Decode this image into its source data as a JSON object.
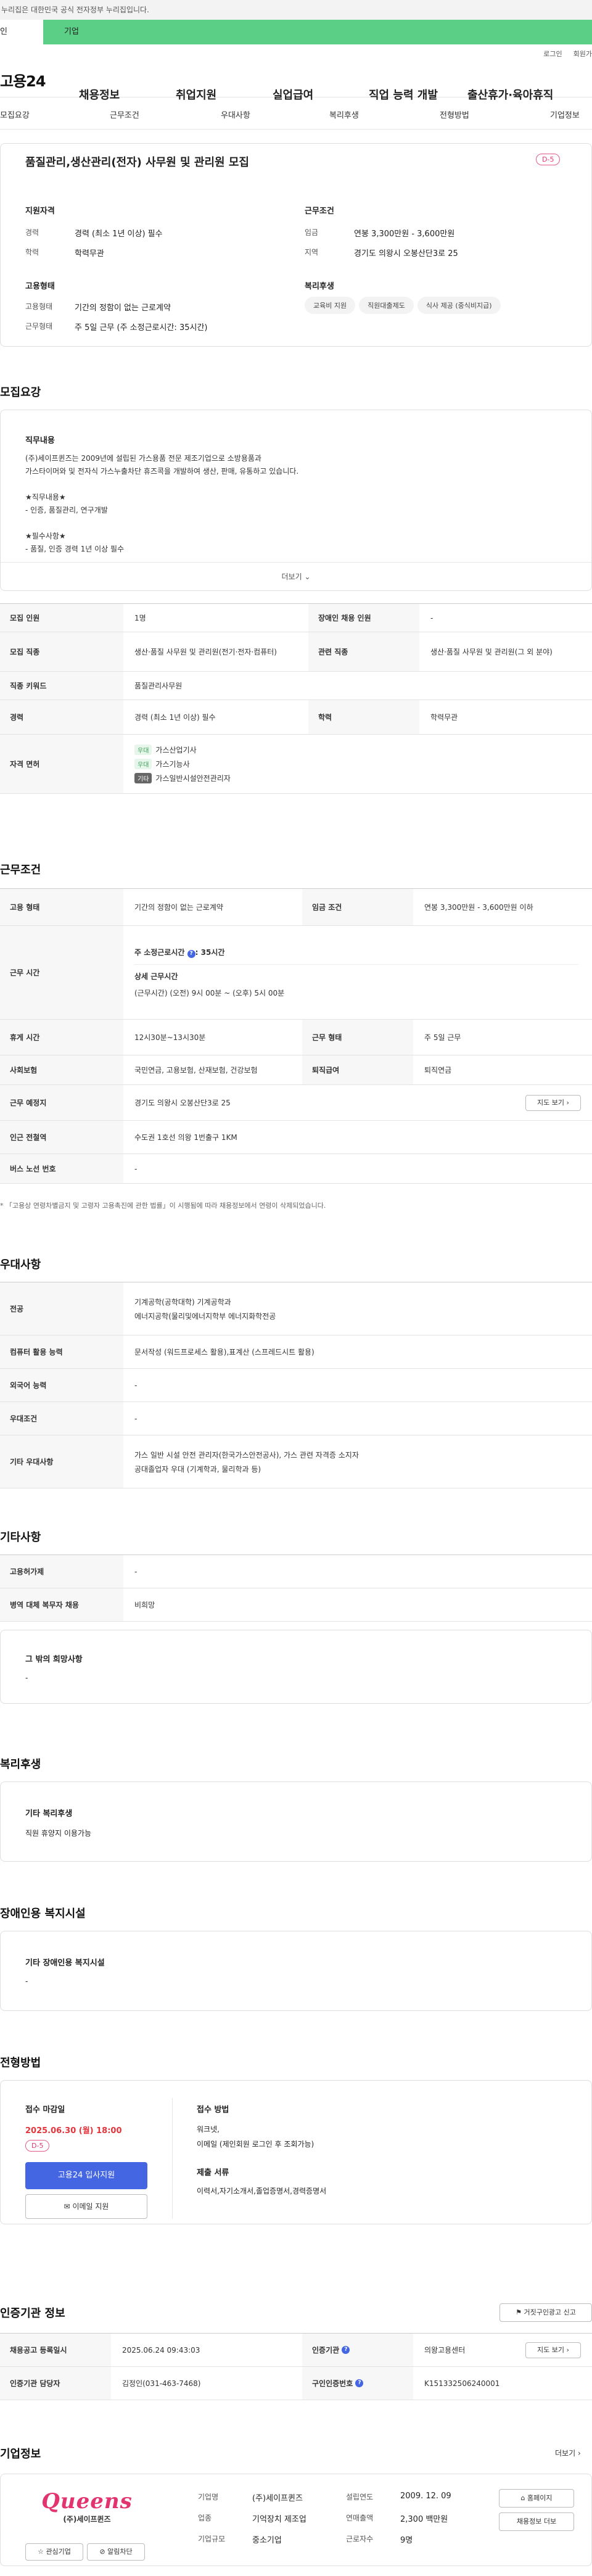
{
  "gov_banner": "누리집은 대한민국 공식 전자정부 누리집입니다.",
  "tabs": {
    "personal": "인",
    "company": "기업"
  },
  "util": {
    "login": "로그인",
    "join": "회원가"
  },
  "logo": "고용24",
  "gnb": [
    "채용정보",
    "취업지원",
    "실업급여",
    "직업 능력 개발",
    "출산휴가·육아휴직"
  ],
  "subnav": [
    "모집요강",
    "근무조건",
    "우대사항",
    "복리후생",
    "전형방법",
    "기업정보"
  ],
  "job_title": "품질관리,생산관리(전자) 사무원 및 관리원 모집",
  "dday": "D-5",
  "summary": {
    "qual_title": "지원자격",
    "career_l": "경력",
    "career_v": "경력 (최소 1년 이상) 필수",
    "edu_l": "학력",
    "edu_v": "학력무관",
    "cond_title": "근무조건",
    "wage_l": "임금",
    "wage_v": "연봉 3,300만원 - 3,600만원",
    "loc_l": "지역",
    "loc_v": "경기도 의왕시 오봉산단3로 25",
    "emp_title": "고용형태",
    "emptype_l": "고용형태",
    "emptype_v": "기간의 정함이 없는 근로계약",
    "worktype_l": "근무형태",
    "worktype_v": "주 5일 근무 (주 소정근로시간: 35시간)",
    "welfare_title": "복리후생",
    "welfare_chips": [
      "교육비 지원",
      "직원대출제도",
      "식사 제공 (중식비지급)"
    ]
  },
  "recruit": {
    "title": "모집요강",
    "duty_title": "직무내용",
    "desc_lines": [
      "(주)세이프퀸즈는 2009년에 설립된 가스용품 전문 제조기업으로 소방용품과",
      "가스타이머와 및 전자식 가스누출차단 휴즈콕을 개발하여 생산, 판매, 유통하고 있습니다.",
      "",
      "★직무내용★",
      "- 인증, 품질관리, 연구개발",
      "",
      "★필수사항★",
      "- 품질, 인증 경력 1년 이상 필수"
    ],
    "more": "더보기",
    "rows": {
      "count_l": "모집 인원",
      "count_v": "1명",
      "disabled_l": "장애인 채용 인원",
      "disabled_v": "-",
      "job_l": "모집 직종",
      "job_v": "생산·품질 사무원 및 관리원(전기·전자·컴퓨터)",
      "rel_l": "관련 직종",
      "rel_v": "생산·품질 사무원 및 관리원(그 외 분야)",
      "kw_l": "직종 키워드",
      "kw_v": "품질관리사무원",
      "career_l": "경력",
      "career_v": "경력 (최소 1년 이상) 필수",
      "edu_l": "학력",
      "edu_v": "학력무관",
      "license_l": "자격 면허",
      "licenses": [
        {
          "tag": "우대",
          "name": "가스산업기사"
        },
        {
          "tag": "우대",
          "name": "가스기능사"
        },
        {
          "tag": "기타",
          "name": "가스일반시설안전관리자"
        }
      ]
    }
  },
  "conditions": {
    "title": "근무조건",
    "emptype_l": "고용 형태",
    "emptype_v": "기간의 정함이 없는 근로계약",
    "wage_l": "임금 조건",
    "wage_v": "연봉 3,300만원 - 3,600만원 이하",
    "hours_l": "근무 시간",
    "weekly": "주 소정근로시간",
    "weekly_v": "35시간",
    "detail_l": "상세 근무시간",
    "detail_v": "(근무시간) (오전) 9시 00분 ~ (오후) 5시 00분",
    "break_l": "휴게 시간",
    "break_v": "12시30분~13시30분",
    "form_l": "근무 형태",
    "form_v": "주 5일 근무",
    "insure_l": "사회보험",
    "insure_v": "국민연금, 고용보험, 산재보험, 건강보험",
    "sev_l": "퇴직급여",
    "sev_v": "퇴직연금",
    "place_l": "근무 예정지",
    "place_v": "경기도 의왕시 오봉산단3로 25",
    "map_btn": "지도 보기",
    "subway_l": "인근 전철역",
    "subway_v": "수도권 1호선 의왕 1번출구 1KM",
    "bus_l": "버스 노선 번호",
    "bus_v": "-",
    "note": "* 「고용상 연령차별금지 및 고령자 고용촉진에 관한 법률」이 시행됨에 따라 채용정보에서 연령이 삭제되었습니다."
  },
  "pref": {
    "title": "우대사항",
    "major_l": "전공",
    "major_v1": "기계공학(공학대학) 기계공학과",
    "major_v2": "에너지공학(물리및에너지학부 에너지화학전공",
    "pc_l": "컴퓨터 활용 능력",
    "pc_v": "문서작성 (워드프로세스 활용),표계산 (스프레드시트 활용)",
    "lang_l": "외국어 능력",
    "lang_v": "-",
    "cond_l": "우대조건",
    "cond_v": "-",
    "etc_l": "기타 우대사항",
    "etc_v1": "가스 일반 시설 안전 관리자(한국가스안전공사), 가스 관련 자격증 소지자",
    "etc_v2": "공대졸업자 우대 (기계학과, 물리학과 등)"
  },
  "other": {
    "title": "기타사항",
    "hire_l": "고용허가제",
    "hire_v": "-",
    "mil_l": "병역 대체 복무자 채용",
    "mil_v": "비희망",
    "hope_title": "그 밖의 희망사항",
    "hope_v": "-"
  },
  "welfare": {
    "title": "복리후생",
    "sub": "기타 복리후생",
    "v": "직원 휴양지 이용가능"
  },
  "disabled": {
    "title": "장애인용 복지시설",
    "sub": "기타 장애인용 복지시설",
    "v": "-"
  },
  "selection": {
    "title": "전형방법",
    "deadline_l": "접수 마감일",
    "deadline_v": "2025.06.30 (월) 18:00",
    "dday": "D-5",
    "apply_btn": "고용24 입사지원",
    "email_btn": "이메일 지원",
    "method_l": "접수 방법",
    "method_v1": "워크넷,",
    "method_v2": "이메일 (제인회원 로그인 후 조회가능)",
    "docs_l": "제출 서류",
    "docs_v": "이력서,자기소개서,졸업증명서,경력증명서"
  },
  "auth": {
    "title": "인증기관 정보",
    "report_btn": "거짓구인광고 신고",
    "reg_l": "채용공고 등록일시",
    "reg_v": "2025.06.24 09:43:03",
    "org_l": "인증기관",
    "org_v": "의왕고용센터",
    "map_btn": "지도 보기",
    "mgr_l": "인증기관 담당자",
    "mgr_v": "김정인(031-463-7468)",
    "no_l": "구인인증번호",
    "no_v": "K151332506240001"
  },
  "company": {
    "title": "기업정보",
    "more": "더보기",
    "brand": "Queens",
    "brand_sub": "(주)세이프퀸즈",
    "name_l": "기업명",
    "name_v": "(주)세이프퀸즈",
    "year_l": "설립연도",
    "year_v": "2009. 12. 09",
    "ind_l": "업종",
    "ind_v": "기억장치 제조업",
    "sales_l": "연매출액",
    "sales_v": "2,300 백만원",
    "size_l": "기업규모",
    "size_v": "중소기업",
    "emp_l": "근로자수",
    "emp_v": "9명",
    "fav_btn": "관심기업",
    "alarm_btn": "알림차단",
    "home_btn": "홈페이지",
    "other_btn": "채용정보 더보"
  },
  "colors": {
    "accent": "#4466e3",
    "brand_green": "#5ccf87",
    "dday": "#e2356f",
    "deadline_red": "#e2353c"
  }
}
